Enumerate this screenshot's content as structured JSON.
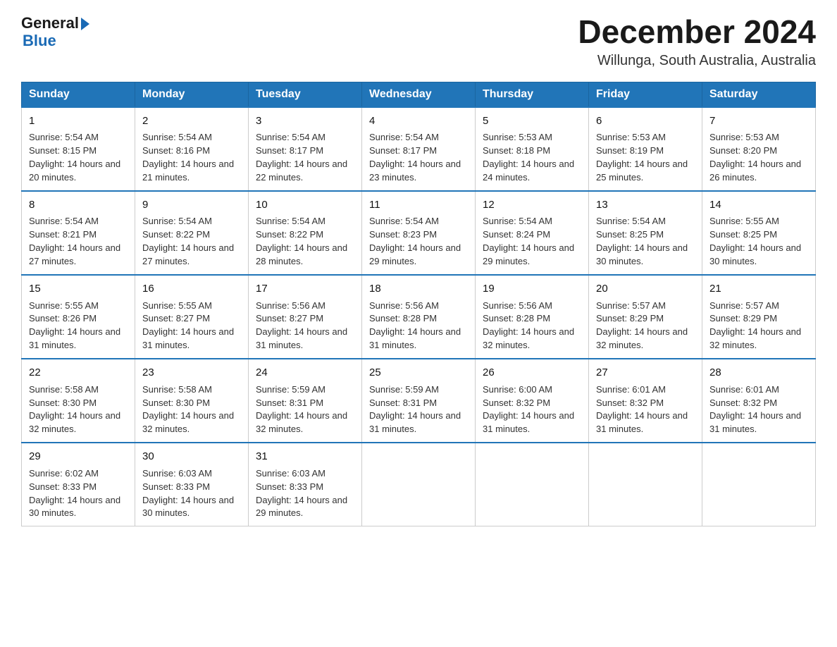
{
  "header": {
    "logo": {
      "text_general": "General",
      "text_blue": "Blue",
      "arrow": true
    },
    "month_title": "December 2024",
    "location": "Willunga, South Australia, Australia"
  },
  "calendar": {
    "days_of_week": [
      "Sunday",
      "Monday",
      "Tuesday",
      "Wednesday",
      "Thursday",
      "Friday",
      "Saturday"
    ],
    "weeks": [
      [
        {
          "day": "1",
          "sunrise": "5:54 AM",
          "sunset": "8:15 PM",
          "daylight": "14 hours and 20 minutes."
        },
        {
          "day": "2",
          "sunrise": "5:54 AM",
          "sunset": "8:16 PM",
          "daylight": "14 hours and 21 minutes."
        },
        {
          "day": "3",
          "sunrise": "5:54 AM",
          "sunset": "8:17 PM",
          "daylight": "14 hours and 22 minutes."
        },
        {
          "day": "4",
          "sunrise": "5:54 AM",
          "sunset": "8:17 PM",
          "daylight": "14 hours and 23 minutes."
        },
        {
          "day": "5",
          "sunrise": "5:53 AM",
          "sunset": "8:18 PM",
          "daylight": "14 hours and 24 minutes."
        },
        {
          "day": "6",
          "sunrise": "5:53 AM",
          "sunset": "8:19 PM",
          "daylight": "14 hours and 25 minutes."
        },
        {
          "day": "7",
          "sunrise": "5:53 AM",
          "sunset": "8:20 PM",
          "daylight": "14 hours and 26 minutes."
        }
      ],
      [
        {
          "day": "8",
          "sunrise": "5:54 AM",
          "sunset": "8:21 PM",
          "daylight": "14 hours and 27 minutes."
        },
        {
          "day": "9",
          "sunrise": "5:54 AM",
          "sunset": "8:22 PM",
          "daylight": "14 hours and 27 minutes."
        },
        {
          "day": "10",
          "sunrise": "5:54 AM",
          "sunset": "8:22 PM",
          "daylight": "14 hours and 28 minutes."
        },
        {
          "day": "11",
          "sunrise": "5:54 AM",
          "sunset": "8:23 PM",
          "daylight": "14 hours and 29 minutes."
        },
        {
          "day": "12",
          "sunrise": "5:54 AM",
          "sunset": "8:24 PM",
          "daylight": "14 hours and 29 minutes."
        },
        {
          "day": "13",
          "sunrise": "5:54 AM",
          "sunset": "8:25 PM",
          "daylight": "14 hours and 30 minutes."
        },
        {
          "day": "14",
          "sunrise": "5:55 AM",
          "sunset": "8:25 PM",
          "daylight": "14 hours and 30 minutes."
        }
      ],
      [
        {
          "day": "15",
          "sunrise": "5:55 AM",
          "sunset": "8:26 PM",
          "daylight": "14 hours and 31 minutes."
        },
        {
          "day": "16",
          "sunrise": "5:55 AM",
          "sunset": "8:27 PM",
          "daylight": "14 hours and 31 minutes."
        },
        {
          "day": "17",
          "sunrise": "5:56 AM",
          "sunset": "8:27 PM",
          "daylight": "14 hours and 31 minutes."
        },
        {
          "day": "18",
          "sunrise": "5:56 AM",
          "sunset": "8:28 PM",
          "daylight": "14 hours and 31 minutes."
        },
        {
          "day": "19",
          "sunrise": "5:56 AM",
          "sunset": "8:28 PM",
          "daylight": "14 hours and 32 minutes."
        },
        {
          "day": "20",
          "sunrise": "5:57 AM",
          "sunset": "8:29 PM",
          "daylight": "14 hours and 32 minutes."
        },
        {
          "day": "21",
          "sunrise": "5:57 AM",
          "sunset": "8:29 PM",
          "daylight": "14 hours and 32 minutes."
        }
      ],
      [
        {
          "day": "22",
          "sunrise": "5:58 AM",
          "sunset": "8:30 PM",
          "daylight": "14 hours and 32 minutes."
        },
        {
          "day": "23",
          "sunrise": "5:58 AM",
          "sunset": "8:30 PM",
          "daylight": "14 hours and 32 minutes."
        },
        {
          "day": "24",
          "sunrise": "5:59 AM",
          "sunset": "8:31 PM",
          "daylight": "14 hours and 32 minutes."
        },
        {
          "day": "25",
          "sunrise": "5:59 AM",
          "sunset": "8:31 PM",
          "daylight": "14 hours and 31 minutes."
        },
        {
          "day": "26",
          "sunrise": "6:00 AM",
          "sunset": "8:32 PM",
          "daylight": "14 hours and 31 minutes."
        },
        {
          "day": "27",
          "sunrise": "6:01 AM",
          "sunset": "8:32 PM",
          "daylight": "14 hours and 31 minutes."
        },
        {
          "day": "28",
          "sunrise": "6:01 AM",
          "sunset": "8:32 PM",
          "daylight": "14 hours and 31 minutes."
        }
      ],
      [
        {
          "day": "29",
          "sunrise": "6:02 AM",
          "sunset": "8:33 PM",
          "daylight": "14 hours and 30 minutes."
        },
        {
          "day": "30",
          "sunrise": "6:03 AM",
          "sunset": "8:33 PM",
          "daylight": "14 hours and 30 minutes."
        },
        {
          "day": "31",
          "sunrise": "6:03 AM",
          "sunset": "8:33 PM",
          "daylight": "14 hours and 29 minutes."
        },
        null,
        null,
        null,
        null
      ]
    ]
  }
}
